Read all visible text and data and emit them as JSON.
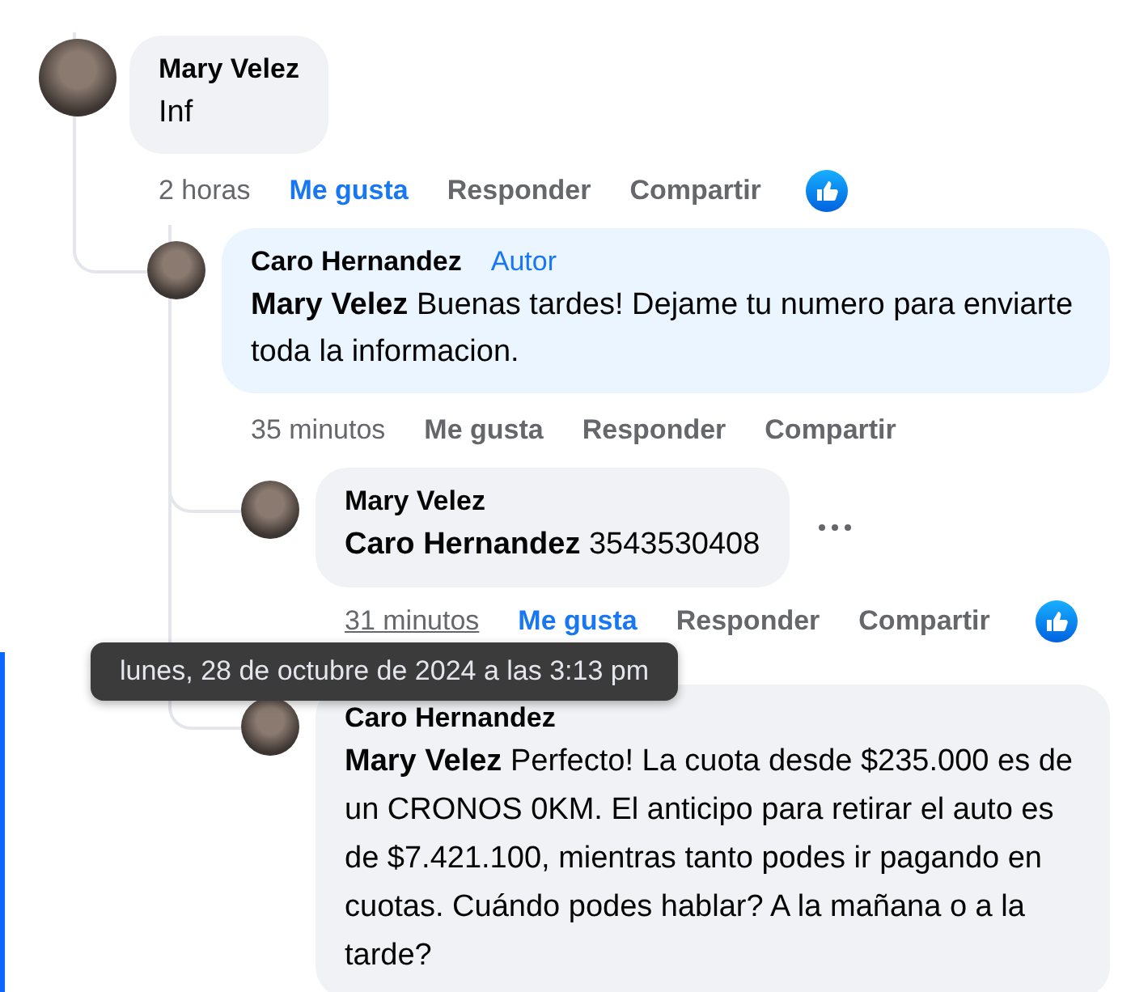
{
  "comments": [
    {
      "author": "Mary Velez",
      "text": "Inf",
      "time": "2 horas",
      "time_underlined": false,
      "like_label": "Me gusta",
      "like_selected": true,
      "reply_label": "Responder",
      "share_label": "Compartir",
      "reaction": true,
      "children": [
        {
          "author": "Caro Hernandez",
          "badge": "Autor",
          "text": "**Mary Velez** Buenas tardes! Dejame tu numero para enviarte toda la informacion.",
          "time": "35 minutos",
          "time_underlined": false,
          "like_label": "Me gusta",
          "like_selected": false,
          "reply_label": "Responder",
          "share_label": "Compartir",
          "children": [
            {
              "author": "Mary Velez",
              "text": "**Caro Hernandez** 3543530408",
              "time": "31 minutos",
              "time_underlined": true,
              "like_label": "Me gusta",
              "like_selected": true,
              "reply_label": "Responder",
              "share_label": "Compartir",
              "reaction": true,
              "options_menu": true
            },
            {
              "author": "Caro Hernandez",
              "text": "**Mary Velez** Perfecto! La cuota desde $235.000 es de un CRONOS 0KM. El anticipo para retirar el auto es de $7.421.100, mientras tanto podes ir pagando en cuotas. Cuándo podes hablar? A la mañana o a la tarde?"
            }
          ]
        }
      ]
    }
  ],
  "tooltip": {
    "text": "lunes, 28 de octubre de 2024 a las 3:13 pm"
  }
}
